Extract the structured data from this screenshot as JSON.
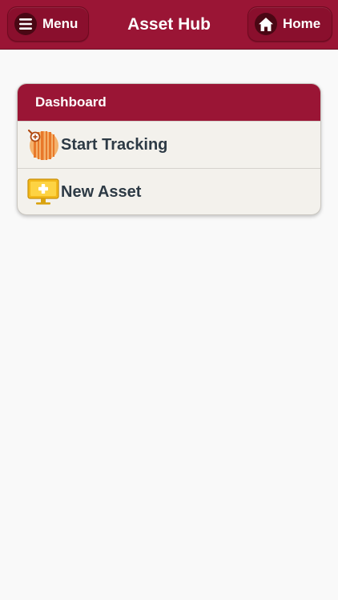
{
  "header": {
    "title": "Asset Hub",
    "menu_label": "Menu",
    "home_label": "Home",
    "menu_icon": "hamburger-icon",
    "home_icon": "house-icon",
    "accent_color": "#9a1535"
  },
  "dashboard": {
    "title": "Dashboard",
    "items": [
      {
        "label": "Start Tracking",
        "icon": "barcode-scan-icon"
      },
      {
        "label": "New Asset",
        "icon": "monitor-add-icon"
      }
    ]
  }
}
